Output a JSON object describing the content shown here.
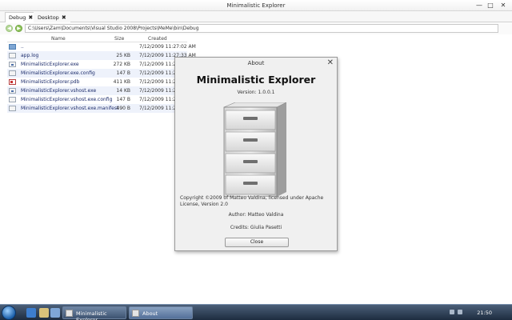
{
  "window": {
    "title": "Minimalistic Explorer",
    "minimize_glyph": "—",
    "maximize_glyph": "□",
    "close_glyph": "✕"
  },
  "tabs": [
    {
      "label": "Debug",
      "close_glyph": "✖",
      "active": true
    },
    {
      "label": "Desktop",
      "close_glyph": "✖",
      "active": false
    }
  ],
  "address": {
    "back_glyph": "◀",
    "forward_glyph": "▶",
    "path": "C:\\Users\\Zam\\Documents\\Visual Studio 2008\\Projects\\MeMe\\bin\\Debug"
  },
  "file_list": {
    "columns": {
      "name": "Name",
      "size": "Size",
      "created": "Created"
    },
    "rows": [
      {
        "name": "..",
        "size": "",
        "created": "7/12/2009 11:27:02 AM",
        "icon": "folder-icon"
      },
      {
        "name": "app.log",
        "size": "25 KB",
        "created": "7/12/2009 11:27:33 AM",
        "icon": "log-file-icon"
      },
      {
        "name": "MinimalisticExplorer.exe",
        "size": "272 KB",
        "created": "7/12/2009 11:27:30",
        "icon": "exe-file-icon"
      },
      {
        "name": "MinimalisticExplorer.exe.config",
        "size": "147 B",
        "created": "7/12/2009 11:27:08",
        "icon": "config-file-icon"
      },
      {
        "name": "MinimalisticExplorer.pdb",
        "size": "411 KB",
        "created": "7/12/2009 11:27:30",
        "icon": "pdb-file-icon"
      },
      {
        "name": "MinimalisticExplorer.vshost.exe",
        "size": "14 KB",
        "created": "7/12/2009 11:27:08",
        "icon": "exe-file-icon"
      },
      {
        "name": "MinimalisticExplorer.vshost.exe.config",
        "size": "147 B",
        "created": "7/12/2009 11:27:08",
        "icon": "config-file-icon"
      },
      {
        "name": "MinimalisticExplorer.vshost.exe.manifest",
        "size": "490 B",
        "created": "7/12/2009 11:27:08",
        "icon": "manifest-file-icon"
      }
    ]
  },
  "about_dialog": {
    "title": "About",
    "close_glyph": "✕",
    "app_name": "Minimalistic Explorer",
    "version": "Version: 1.0.0.1",
    "copyright": "Copyright ©2009 of Matteo Valdina, licensed under Apache License, Version 2.0",
    "author": "Author: Matteo Valdina",
    "credits": "Credits: Giulia Pasetti",
    "close_button": "Close"
  },
  "taskbar": {
    "items": [
      {
        "label": "Minimalistic Explorer",
        "active": false
      },
      {
        "label": "About",
        "active": true
      }
    ],
    "clock": "21:50"
  },
  "colors": {
    "accent": "#1a2a6a",
    "row_alt": "#eef2fb",
    "nav_green": "#8fc45b",
    "taskbar": "#2a3b52"
  }
}
